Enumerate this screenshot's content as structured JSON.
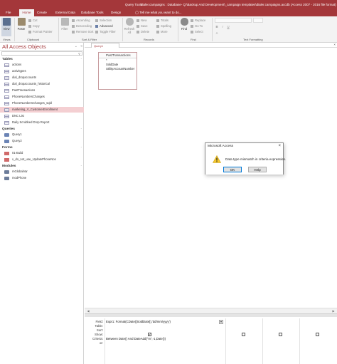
{
  "titlebar": {
    "context_tab": "Query Tools",
    "title": "dialer.campaigns : Database- Q:\\Backup And Development\\_campaign templates\\dialer.campaigns.accdb (Access 2007 - 2016 file format) - Access"
  },
  "tabs": [
    "File",
    "Home",
    "Create",
    "External Data",
    "Database Tools",
    "Design"
  ],
  "tell_me": "Tell me what you want to do...",
  "ribbon": {
    "view": "View",
    "paste": "Paste",
    "cut": "Cut",
    "copy": "Copy",
    "format_painter": "Format Painter",
    "filter": "Filter",
    "ascending": "Ascending",
    "descending": "Descending",
    "remove_sort": "Remove Sort",
    "selection": "Selection",
    "advanced": "Advanced",
    "toggle_filter": "Toggle Filter",
    "refresh_all": "Refresh All",
    "new": "New",
    "save": "Save",
    "delete": "Delete",
    "totals": "Totals",
    "spelling": "Spelling",
    "more": "More",
    "find": "Find",
    "replace": "Replace",
    "go_to": "Go To",
    "select": "Select",
    "bold": "B",
    "italic": "I",
    "underline": "U",
    "font_color": "A",
    "groups": {
      "views": "Views",
      "clipboard": "Clipboard",
      "sort_filter": "Sort & Filter",
      "records": "Records",
      "find": "Find",
      "text_formatting": "Text Formatting"
    }
  },
  "nav": {
    "title": "All Access Objects",
    "sections": [
      {
        "name": "Tables",
        "items": [
          "actions",
          "activitypes",
          "dial_dropaccounts",
          "dial_dropaccounts_historical",
          "PastTransactions",
          "PhoneNumbersChanges",
          "PhoneNumbersChanges_sqld",
          "marketing_V_CustomerEnrollment",
          "DNC List",
          "Daily Scrubbed Drop Report"
        ]
      },
      {
        "name": "Queries",
        "items": [
          "Query1",
          "Query2"
        ]
      },
      {
        "name": "Forms",
        "items": [
          "01-Build",
          "x_do_not_use_UpdatePhoneNos"
        ]
      },
      {
        "name": "Modules",
        "items": [
          "mGlobalVar",
          "modPhone"
        ]
      }
    ]
  },
  "query_tab": "Query1",
  "field_list": {
    "table": "PastTransactions",
    "fields": [
      "*",
      "SoldDate",
      "UtilityAccountNumber"
    ]
  },
  "qbe": {
    "row_labels": [
      "Field:",
      "Table:",
      "Sort:",
      "Show:",
      "Criteria:",
      "or:"
    ],
    "field_expr": "Expr1: Format(CDate([SoldDate]),'dd/mm/yyyy')",
    "criteria": "Between Date() And DateAdd(\"m\",-1,Date())"
  },
  "dialog": {
    "title": "Microsoft Access",
    "close": "×",
    "message": "Data type mismatch in criteria expression.",
    "ok": "OK",
    "help": "Help"
  },
  "colors": {
    "accent": "#a4373a",
    "selected_item": "#f4cfd2",
    "ribbon_bg": "#f3f3f3"
  }
}
